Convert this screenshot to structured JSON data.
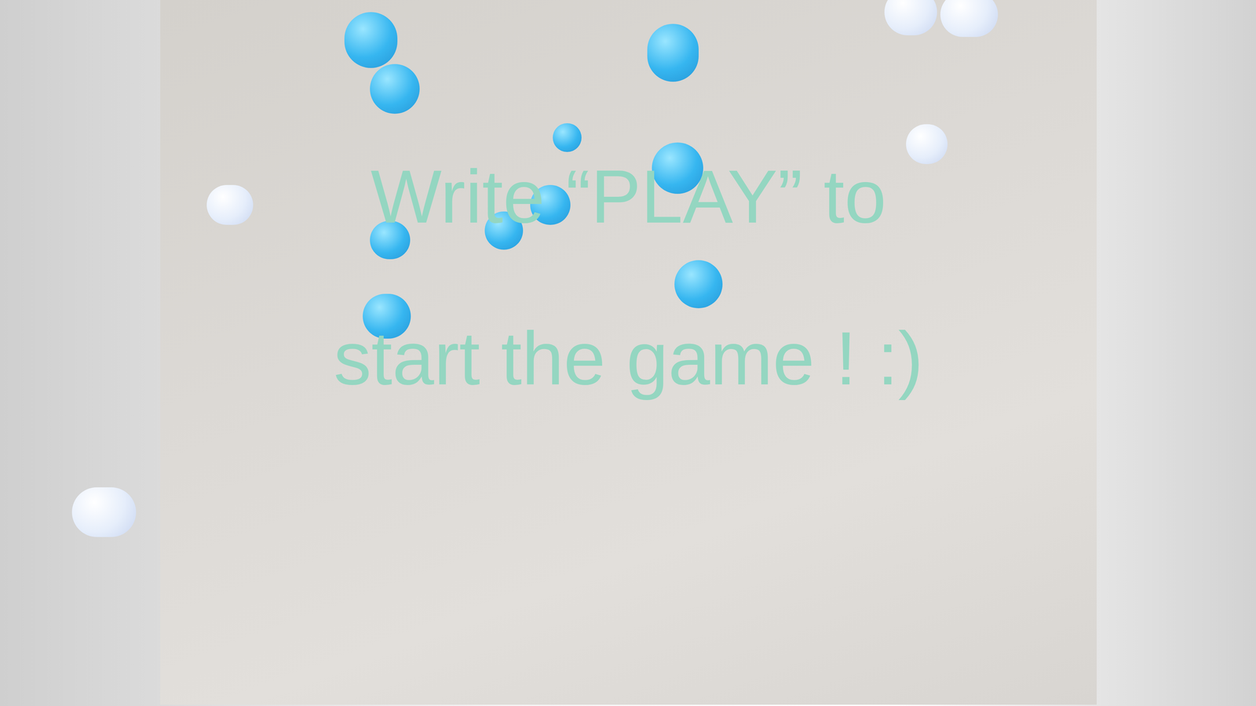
{
  "prompt": {
    "lines": [
      "Write “PLAY” to",
      "start the game ! :)"
    ]
  }
}
